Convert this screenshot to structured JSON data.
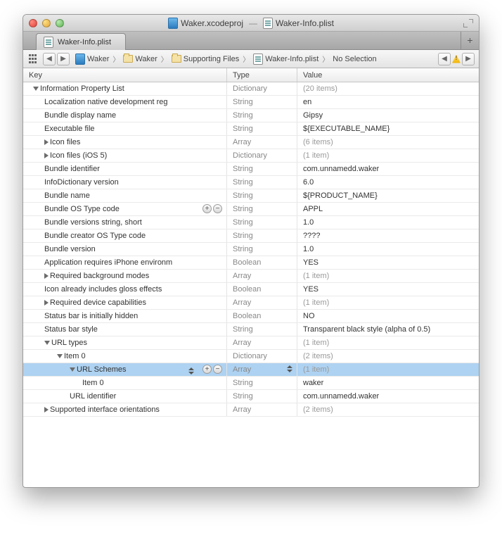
{
  "title": {
    "project": "Waker.xcodeproj",
    "file": "Waker-Info.plist"
  },
  "tab": {
    "label": "Waker-Info.plist"
  },
  "nav": {
    "crumbs": [
      "Waker",
      "Waker",
      "Supporting Files",
      "Waker-Info.plist",
      "No Selection"
    ]
  },
  "columns": {
    "key": "Key",
    "type": "Type",
    "value": "Value"
  },
  "rows": [
    {
      "key": "Information Property List",
      "type": "Dictionary",
      "value": "(20 items)",
      "indent": 0,
      "disclosure": "down",
      "gray": true
    },
    {
      "key": "Localization native development reg",
      "type": "String",
      "value": "en",
      "indent": 1
    },
    {
      "key": "Bundle display name",
      "type": "String",
      "value": "Gipsy",
      "indent": 1
    },
    {
      "key": "Executable file",
      "type": "String",
      "value": "${EXECUTABLE_NAME}",
      "indent": 1
    },
    {
      "key": "Icon files",
      "type": "Array",
      "value": "(6 items)",
      "indent": 1,
      "disclosure": "right",
      "gray": true
    },
    {
      "key": "Icon files (iOS 5)",
      "type": "Dictionary",
      "value": "(1 item)",
      "indent": 1,
      "disclosure": "right",
      "gray": true
    },
    {
      "key": "Bundle identifier",
      "type": "String",
      "value": "com.unnamedd.waker",
      "indent": 1
    },
    {
      "key": "InfoDictionary version",
      "type": "String",
      "value": "6.0",
      "indent": 1
    },
    {
      "key": "Bundle name",
      "type": "String",
      "value": "${PRODUCT_NAME}",
      "indent": 1
    },
    {
      "key": "Bundle OS Type code",
      "type": "String",
      "value": "APPL",
      "indent": 1,
      "plusminus": true
    },
    {
      "key": "Bundle versions string, short",
      "type": "String",
      "value": "1.0",
      "indent": 1
    },
    {
      "key": "Bundle creator OS Type code",
      "type": "String",
      "value": "????",
      "indent": 1
    },
    {
      "key": "Bundle version",
      "type": "String",
      "value": "1.0",
      "indent": 1
    },
    {
      "key": "Application requires iPhone environm",
      "type": "Boolean",
      "value": "YES",
      "indent": 1
    },
    {
      "key": "Required background modes",
      "type": "Array",
      "value": "(1 item)",
      "indent": 1,
      "disclosure": "right",
      "gray": true
    },
    {
      "key": "Icon already includes gloss effects",
      "type": "Boolean",
      "value": "YES",
      "indent": 1
    },
    {
      "key": "Required device capabilities",
      "type": "Array",
      "value": "(1 item)",
      "indent": 1,
      "disclosure": "right",
      "gray": true
    },
    {
      "key": "Status bar is initially hidden",
      "type": "Boolean",
      "value": "NO",
      "indent": 1
    },
    {
      "key": "Status bar style",
      "type": "String",
      "value": "Transparent black style (alpha of 0.5)",
      "indent": 1
    },
    {
      "key": "URL types",
      "type": "Array",
      "value": "(1 item)",
      "indent": 1,
      "disclosure": "down",
      "gray": true
    },
    {
      "key": "Item 0",
      "type": "Dictionary",
      "value": "(2 items)",
      "indent": 2,
      "disclosure": "down",
      "gray": true
    },
    {
      "key": "URL Schemes",
      "type": "Array",
      "value": "(1 item)",
      "indent": 3,
      "disclosure": "down",
      "gray": true,
      "selected": true,
      "plusminus": true,
      "stepper": true
    },
    {
      "key": "Item 0",
      "type": "String",
      "value": "waker",
      "indent": 4
    },
    {
      "key": "URL identifier",
      "type": "String",
      "value": "com.unnamedd.waker",
      "indent": 3
    },
    {
      "key": "Supported interface orientations",
      "type": "Array",
      "value": "(2 items)",
      "indent": 1,
      "disclosure": "right",
      "gray": true
    }
  ]
}
